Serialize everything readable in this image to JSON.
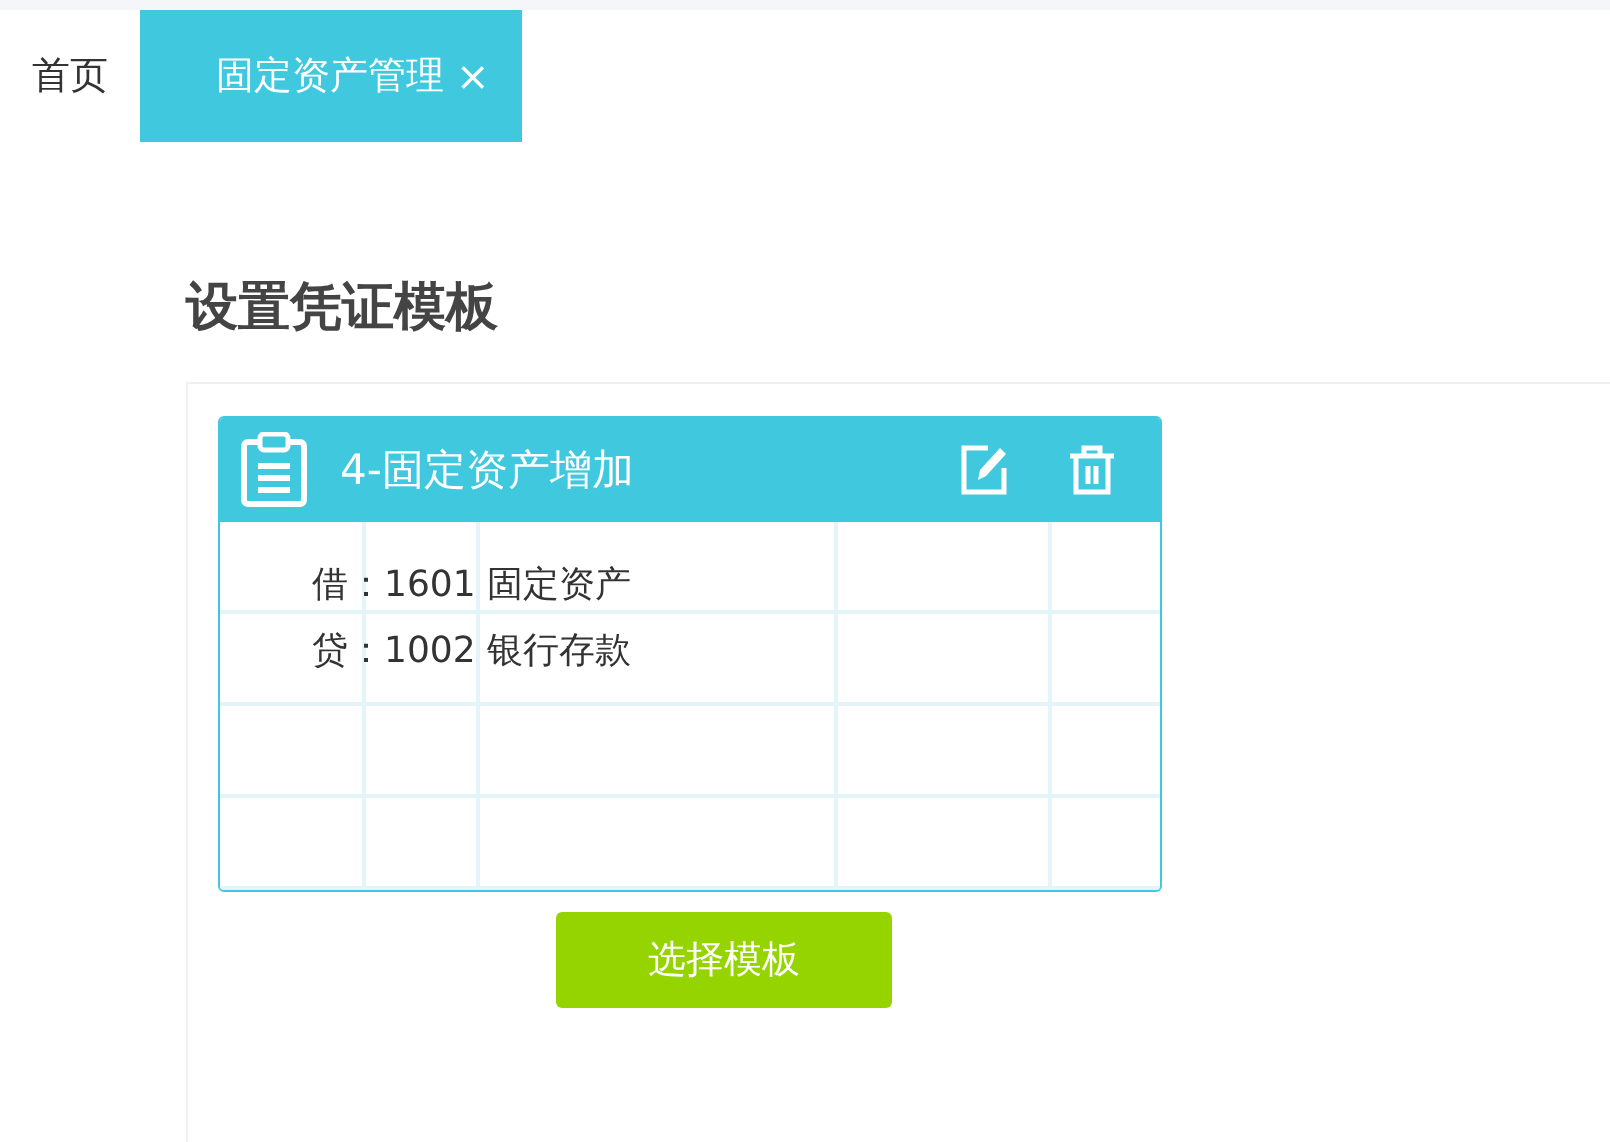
{
  "tabs": [
    {
      "label": "首页",
      "selected": false
    },
    {
      "label": "固定资产管理",
      "selected": true,
      "close": "×"
    }
  ],
  "page_title": "设置凭证模板",
  "template": {
    "title": "4-固定资产增加",
    "entries": [
      "借：1601 固定资产",
      "贷：1002 银行存款"
    ]
  },
  "select_button": "选择模板"
}
